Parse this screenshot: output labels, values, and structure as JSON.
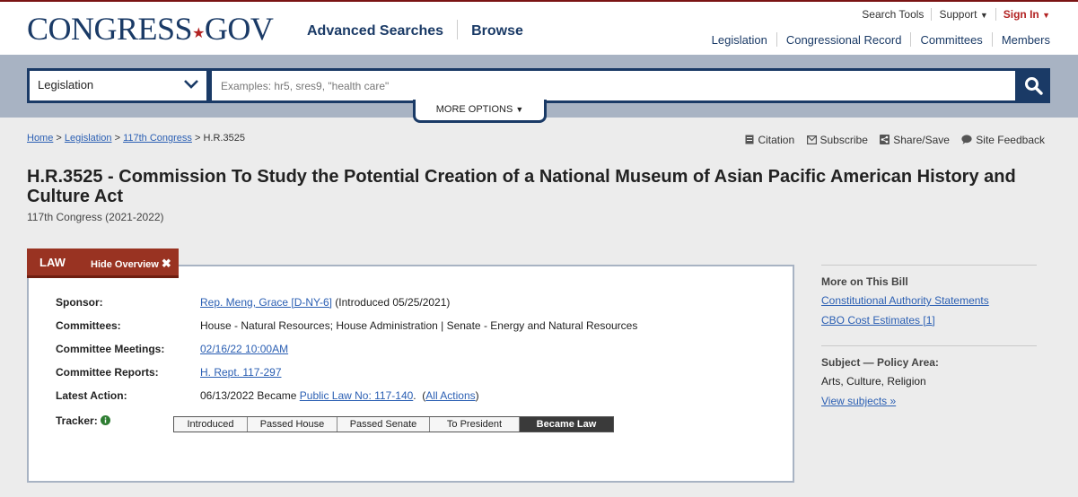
{
  "header": {
    "logo_main": "CONGRESS",
    "logo_star": "★",
    "logo_tld": "GOV",
    "nav": [
      "Advanced Searches",
      "Browse"
    ],
    "util": {
      "search_tools": "Search Tools",
      "support": "Support",
      "sign_in": "Sign In"
    },
    "subnav": [
      "Legislation",
      "Congressional Record",
      "Committees",
      "Members"
    ]
  },
  "search": {
    "scope": "Legislation",
    "placeholder": "Examples: hr5, sres9, \"health care\"",
    "more_options": "MORE OPTIONS"
  },
  "breadcrumb": {
    "items": [
      "Home",
      "Legislation",
      "117th Congress"
    ],
    "current": "H.R.3525",
    "sep": ">"
  },
  "tools": [
    "Citation",
    "Subscribe",
    "Share/Save",
    "Site Feedback"
  ],
  "bill": {
    "title": "H.R.3525 - Commission To Study the Potential Creation of a National Museum of Asian Pacific American History and Culture Act",
    "congress": "117th Congress (2021-2022)"
  },
  "tab": {
    "law": "LAW",
    "hide": "Hide Overview"
  },
  "overview": {
    "sponsor_label": "Sponsor:",
    "sponsor_link": "Rep. Meng, Grace [D-NY-6]",
    "sponsor_note": "(Introduced 05/25/2021)",
    "committees_label": "Committees:",
    "committees": "House - Natural Resources; House Administration | Senate - Energy and Natural Resources",
    "meetings_label": "Committee Meetings:",
    "meetings_link": "02/16/22 10:00AM",
    "reports_label": "Committee Reports:",
    "reports_link": "H. Rept. 117-297",
    "latest_label": "Latest Action:",
    "latest_text": "06/13/2022 Became",
    "latest_link": "Public Law No: 117-140",
    "all_actions": "All Actions",
    "tracker_label": "Tracker:",
    "tracker_steps": [
      "Introduced",
      "Passed House",
      "Passed Senate",
      "To President",
      "Became Law"
    ]
  },
  "sidebar": {
    "more_head": "More on This Bill",
    "links": [
      "Constitutional Authority Statements",
      "CBO Cost Estimates [1]"
    ],
    "subject_head": "Subject — Policy Area:",
    "subject": "Arts, Culture, Religion",
    "view_subjects": "View subjects"
  },
  "colors": {
    "navy": "#1a3a66",
    "brand_red": "#993322",
    "link": "#2b5fb3"
  }
}
